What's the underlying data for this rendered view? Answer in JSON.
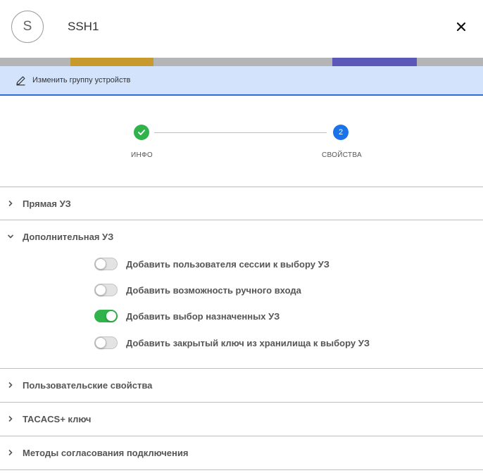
{
  "header": {
    "avatar_letter": "S",
    "title": "SSH1"
  },
  "edit_bar": {
    "label": "Изменить группу устройств"
  },
  "stepper": {
    "steps": [
      {
        "label": "ИНФО",
        "state": "done"
      },
      {
        "label": "СВОЙСТВА",
        "number": "2",
        "state": "active"
      }
    ]
  },
  "sections": [
    {
      "label": "Прямая УЗ",
      "expanded": false
    },
    {
      "label": "Дополнительная УЗ",
      "expanded": true
    },
    {
      "label": "Пользовательские свойства",
      "expanded": false
    },
    {
      "label": "TACACS+ ключ",
      "expanded": false
    },
    {
      "label": "Методы согласования подключения",
      "expanded": false
    }
  ],
  "toggles": [
    {
      "label": "Добавить пользователя сессии к выбору УЗ",
      "on": false
    },
    {
      "label": "Добавить возможность ручного входа",
      "on": false
    },
    {
      "label": "Добавить выбор назначенных УЗ",
      "on": true
    },
    {
      "label": "Добавить закрытый ключ из хранилища к выбору УЗ",
      "on": false
    }
  ],
  "colors": {
    "accent": "#1a73e8",
    "success": "#2fb34a",
    "edit_bar_bg": "#d3e3fb"
  }
}
